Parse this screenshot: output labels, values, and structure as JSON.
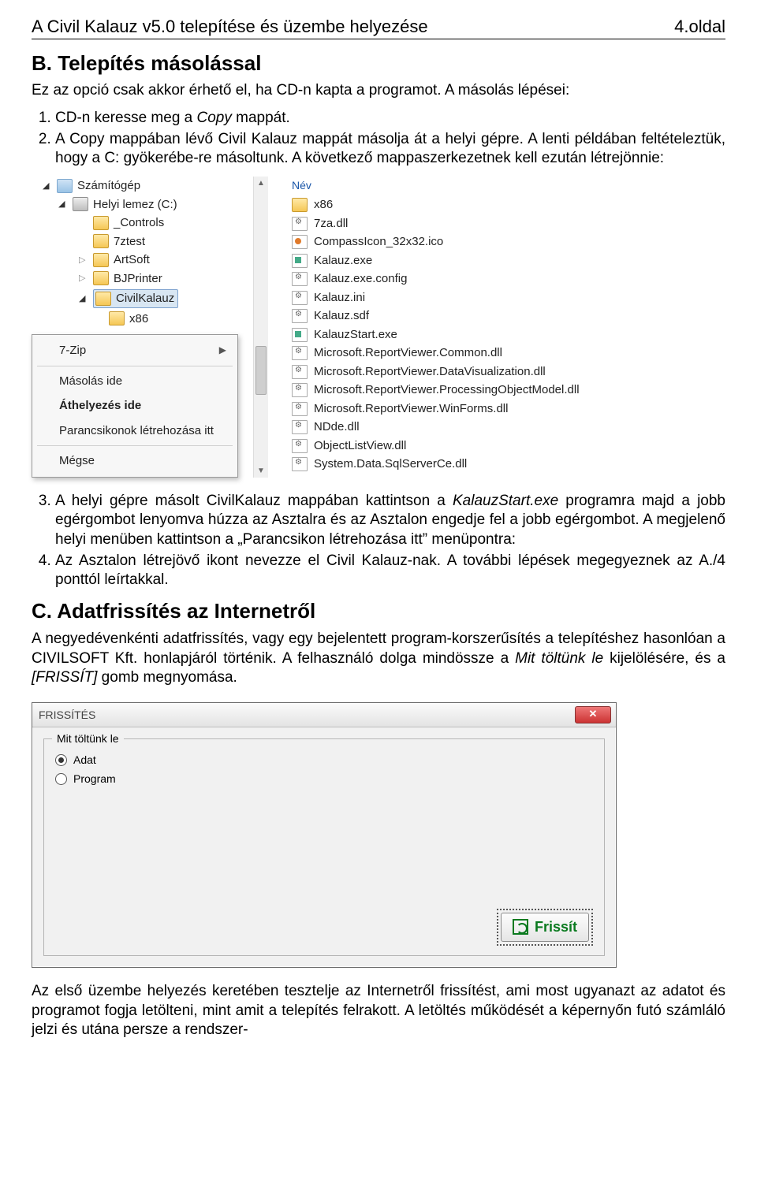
{
  "header": {
    "left": "A Civil Kalauz v5.0 telepítése és üzembe helyezése",
    "right": "4.oldal"
  },
  "sectionB": {
    "title": "B. Telepítés másolással",
    "intro": "Ez az opció csak akkor érhető el, ha CD-n kapta a programot. A másolás lépései:",
    "step1_a": "CD-n keresse meg a ",
    "step1_i": "Copy",
    "step1_b": " mappát.",
    "step2": "A Copy mappában lévő Civil Kalauz mappát másolja át a helyi gépre. A lenti példában feltételeztük, hogy a C: gyökerébe-re másoltunk. A következő mappaszerkezetnek kell ezután létrejönnie:",
    "step3_a": "A helyi gépre másolt CivilKalauz mappában kattintson a ",
    "step3_i": "KalauzStart.exe",
    "step3_b": " programra majd a jobb egérgombot lenyomva húzza az Asztalra és az Asztalon engedje fel a jobb egérgombot. A megjelenő helyi menüben kattintson a „Parancsikon létrehozása itt” menüpontra:",
    "step4": "Az Asztalon létrejövő ikont nevezze el Civil Kalauz-nak. A további lépések megegyeznek az A./4 ponttól leírtakkal."
  },
  "explorer": {
    "tree": {
      "computer": "Számítógép",
      "drive": "Helyi lemez (C:)",
      "folders": [
        "_Controls",
        "7ztest",
        "ArtSoft",
        "BJPrinter",
        "CivilKalauz",
        "x86"
      ]
    },
    "listHeader": "Név",
    "files": [
      {
        "name": "x86",
        "type": "folder"
      },
      {
        "name": "7za.dll",
        "type": "gear"
      },
      {
        "name": "CompassIcon_32x32.ico",
        "type": "ico"
      },
      {
        "name": "Kalauz.exe",
        "type": "exe"
      },
      {
        "name": "Kalauz.exe.config",
        "type": "gear"
      },
      {
        "name": "Kalauz.ini",
        "type": "gear"
      },
      {
        "name": "Kalauz.sdf",
        "type": "gear"
      },
      {
        "name": "KalauzStart.exe",
        "type": "exe"
      },
      {
        "name": "Microsoft.ReportViewer.Common.dll",
        "type": "gear"
      },
      {
        "name": "Microsoft.ReportViewer.DataVisualization.dll",
        "type": "gear"
      },
      {
        "name": "Microsoft.ReportViewer.ProcessingObjectModel.dll",
        "type": "gear"
      },
      {
        "name": "Microsoft.ReportViewer.WinForms.dll",
        "type": "gear"
      },
      {
        "name": "NDde.dll",
        "type": "gear"
      },
      {
        "name": "ObjectListView.dll",
        "type": "gear"
      },
      {
        "name": "System.Data.SqlServerCe.dll",
        "type": "gear"
      }
    ],
    "menu": {
      "sevenZip": "7-Zip",
      "copyHere": "Másolás ide",
      "moveHere": "Áthelyezés ide",
      "shortcut": "Parancsikonok létrehozása itt",
      "cancel": "Mégse"
    }
  },
  "sectionC": {
    "title": "C. Adatfrissítés az Internetről",
    "para_a": "A negyedévenkénti adatfrissítés, vagy egy bejelentett program-korszerűsítés a telepítéshez hasonlóan a CIVILSOFT Kft. honlapjáról történik. A felhasználó dolga mindössze a ",
    "para_i1": "Mit töltünk le",
    "para_b": " kijelölésére, és a ",
    "para_i2": "[FRISSÍT]",
    "para_c": " gomb megnyomása."
  },
  "dialog": {
    "title": "FRISSÍTÉS",
    "group": "Mit töltünk le",
    "opt1": "Adat",
    "opt2": "Program",
    "button": "Frissít"
  },
  "footer": "Az első üzembe helyezés keretében tesztelje az Internetről frissítést, ami most ugyanazt az adatot és programot fogja letölteni, mint amit a telepítés felrakott. A letöltés működését a képernyőn futó számláló jelzi és utána persze a rendszer-"
}
